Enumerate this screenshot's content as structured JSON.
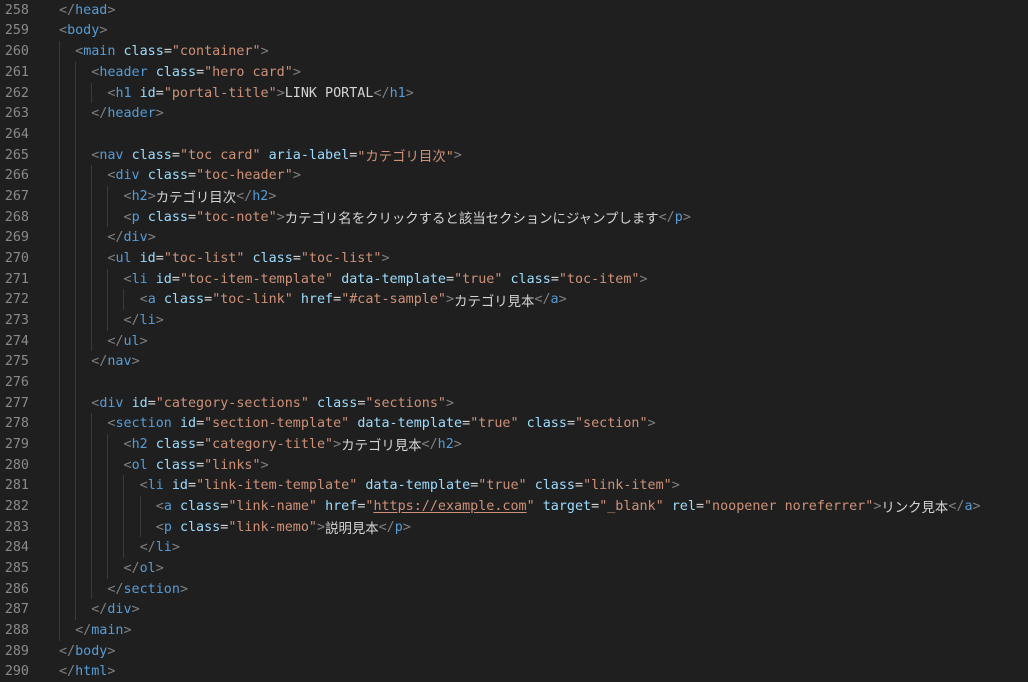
{
  "editor": {
    "language": "html",
    "lines": [
      {
        "num": "258",
        "indent": 0,
        "tokens": [
          [
            "tg",
            "</"
          ],
          [
            "tn",
            "head"
          ],
          [
            "tg",
            ">"
          ]
        ]
      },
      {
        "num": "259",
        "indent": 0,
        "tokens": [
          [
            "tg",
            "<"
          ],
          [
            "tn",
            "body"
          ],
          [
            "tg",
            ">"
          ]
        ]
      },
      {
        "num": "260",
        "indent": 1,
        "tokens": [
          [
            "tg",
            "<"
          ],
          [
            "tn",
            "main"
          ],
          [
            "tx",
            " "
          ],
          [
            "an",
            "class"
          ],
          [
            "eq",
            "="
          ],
          [
            "sv",
            "\"container\""
          ],
          [
            "tg",
            ">"
          ]
        ]
      },
      {
        "num": "261",
        "indent": 2,
        "tokens": [
          [
            "tg",
            "<"
          ],
          [
            "tn",
            "header"
          ],
          [
            "tx",
            " "
          ],
          [
            "an",
            "class"
          ],
          [
            "eq",
            "="
          ],
          [
            "sv",
            "\"hero card\""
          ],
          [
            "tg",
            ">"
          ]
        ]
      },
      {
        "num": "262",
        "indent": 3,
        "tokens": [
          [
            "tg",
            "<"
          ],
          [
            "tn",
            "h1"
          ],
          [
            "tx",
            " "
          ],
          [
            "an",
            "id"
          ],
          [
            "eq",
            "="
          ],
          [
            "sv",
            "\"portal-title\""
          ],
          [
            "tg",
            ">"
          ],
          [
            "tx",
            "LINK PORTAL"
          ],
          [
            "tg",
            "</"
          ],
          [
            "tn",
            "h1"
          ],
          [
            "tg",
            ">"
          ]
        ]
      },
      {
        "num": "263",
        "indent": 2,
        "tokens": [
          [
            "tg",
            "</"
          ],
          [
            "tn",
            "header"
          ],
          [
            "tg",
            ">"
          ]
        ]
      },
      {
        "num": "264",
        "indent": 2,
        "tokens": []
      },
      {
        "num": "265",
        "indent": 2,
        "tokens": [
          [
            "tg",
            "<"
          ],
          [
            "tn",
            "nav"
          ],
          [
            "tx",
            " "
          ],
          [
            "an",
            "class"
          ],
          [
            "eq",
            "="
          ],
          [
            "sv",
            "\"toc card\""
          ],
          [
            "tx",
            " "
          ],
          [
            "an",
            "aria-label"
          ],
          [
            "eq",
            "="
          ],
          [
            "sv",
            "\"カテゴリ目次\""
          ],
          [
            "tg",
            ">"
          ]
        ]
      },
      {
        "num": "266",
        "indent": 3,
        "tokens": [
          [
            "tg",
            "<"
          ],
          [
            "tn",
            "div"
          ],
          [
            "tx",
            " "
          ],
          [
            "an",
            "class"
          ],
          [
            "eq",
            "="
          ],
          [
            "sv",
            "\"toc-header\""
          ],
          [
            "tg",
            ">"
          ]
        ]
      },
      {
        "num": "267",
        "indent": 4,
        "tokens": [
          [
            "tg",
            "<"
          ],
          [
            "tn",
            "h2"
          ],
          [
            "tg",
            ">"
          ],
          [
            "tx",
            "カテゴリ目次"
          ],
          [
            "tg",
            "</"
          ],
          [
            "tn",
            "h2"
          ],
          [
            "tg",
            ">"
          ]
        ]
      },
      {
        "num": "268",
        "indent": 4,
        "tokens": [
          [
            "tg",
            "<"
          ],
          [
            "tn",
            "p"
          ],
          [
            "tx",
            " "
          ],
          [
            "an",
            "class"
          ],
          [
            "eq",
            "="
          ],
          [
            "sv",
            "\"toc-note\""
          ],
          [
            "tg",
            ">"
          ],
          [
            "tx",
            "カテゴリ名をクリックすると該当セクションにジャンプします"
          ],
          [
            "tg",
            "</"
          ],
          [
            "tn",
            "p"
          ],
          [
            "tg",
            ">"
          ]
        ]
      },
      {
        "num": "269",
        "indent": 3,
        "tokens": [
          [
            "tg",
            "</"
          ],
          [
            "tn",
            "div"
          ],
          [
            "tg",
            ">"
          ]
        ]
      },
      {
        "num": "270",
        "indent": 3,
        "tokens": [
          [
            "tg",
            "<"
          ],
          [
            "tn",
            "ul"
          ],
          [
            "tx",
            " "
          ],
          [
            "an",
            "id"
          ],
          [
            "eq",
            "="
          ],
          [
            "sv",
            "\"toc-list\""
          ],
          [
            "tx",
            " "
          ],
          [
            "an",
            "class"
          ],
          [
            "eq",
            "="
          ],
          [
            "sv",
            "\"toc-list\""
          ],
          [
            "tg",
            ">"
          ]
        ]
      },
      {
        "num": "271",
        "indent": 4,
        "tokens": [
          [
            "tg",
            "<"
          ],
          [
            "tn",
            "li"
          ],
          [
            "tx",
            " "
          ],
          [
            "an",
            "id"
          ],
          [
            "eq",
            "="
          ],
          [
            "sv",
            "\"toc-item-template\""
          ],
          [
            "tx",
            " "
          ],
          [
            "an",
            "data-template"
          ],
          [
            "eq",
            "="
          ],
          [
            "sv",
            "\"true\""
          ],
          [
            "tx",
            " "
          ],
          [
            "an",
            "class"
          ],
          [
            "eq",
            "="
          ],
          [
            "sv",
            "\"toc-item\""
          ],
          [
            "tg",
            ">"
          ]
        ]
      },
      {
        "num": "272",
        "indent": 5,
        "tokens": [
          [
            "tg",
            "<"
          ],
          [
            "tn",
            "a"
          ],
          [
            "tx",
            " "
          ],
          [
            "an",
            "class"
          ],
          [
            "eq",
            "="
          ],
          [
            "sv",
            "\"toc-link\""
          ],
          [
            "tx",
            " "
          ],
          [
            "an",
            "href"
          ],
          [
            "eq",
            "="
          ],
          [
            "sv",
            "\"#cat-sample\""
          ],
          [
            "tg",
            ">"
          ],
          [
            "tx",
            "カテゴリ見本"
          ],
          [
            "tg",
            "</"
          ],
          [
            "tn",
            "a"
          ],
          [
            "tg",
            ">"
          ]
        ]
      },
      {
        "num": "273",
        "indent": 4,
        "tokens": [
          [
            "tg",
            "</"
          ],
          [
            "tn",
            "li"
          ],
          [
            "tg",
            ">"
          ]
        ]
      },
      {
        "num": "274",
        "indent": 3,
        "tokens": [
          [
            "tg",
            "</"
          ],
          [
            "tn",
            "ul"
          ],
          [
            "tg",
            ">"
          ]
        ]
      },
      {
        "num": "275",
        "indent": 2,
        "tokens": [
          [
            "tg",
            "</"
          ],
          [
            "tn",
            "nav"
          ],
          [
            "tg",
            ">"
          ]
        ]
      },
      {
        "num": "276",
        "indent": 2,
        "tokens": []
      },
      {
        "num": "277",
        "indent": 2,
        "tokens": [
          [
            "tg",
            "<"
          ],
          [
            "tn",
            "div"
          ],
          [
            "tx",
            " "
          ],
          [
            "an",
            "id"
          ],
          [
            "eq",
            "="
          ],
          [
            "sv",
            "\"category-sections\""
          ],
          [
            "tx",
            " "
          ],
          [
            "an",
            "class"
          ],
          [
            "eq",
            "="
          ],
          [
            "sv",
            "\"sections\""
          ],
          [
            "tg",
            ">"
          ]
        ]
      },
      {
        "num": "278",
        "indent": 3,
        "tokens": [
          [
            "tg",
            "<"
          ],
          [
            "tn",
            "section"
          ],
          [
            "tx",
            " "
          ],
          [
            "an",
            "id"
          ],
          [
            "eq",
            "="
          ],
          [
            "sv",
            "\"section-template\""
          ],
          [
            "tx",
            " "
          ],
          [
            "an",
            "data-template"
          ],
          [
            "eq",
            "="
          ],
          [
            "sv",
            "\"true\""
          ],
          [
            "tx",
            " "
          ],
          [
            "an",
            "class"
          ],
          [
            "eq",
            "="
          ],
          [
            "sv",
            "\"section\""
          ],
          [
            "tg",
            ">"
          ]
        ]
      },
      {
        "num": "279",
        "indent": 4,
        "tokens": [
          [
            "tg",
            "<"
          ],
          [
            "tn",
            "h2"
          ],
          [
            "tx",
            " "
          ],
          [
            "an",
            "class"
          ],
          [
            "eq",
            "="
          ],
          [
            "sv",
            "\"category-title\""
          ],
          [
            "tg",
            ">"
          ],
          [
            "tx",
            "カテゴリ見本"
          ],
          [
            "tg",
            "</"
          ],
          [
            "tn",
            "h2"
          ],
          [
            "tg",
            ">"
          ]
        ]
      },
      {
        "num": "280",
        "indent": 4,
        "tokens": [
          [
            "tg",
            "<"
          ],
          [
            "tn",
            "ol"
          ],
          [
            "tx",
            " "
          ],
          [
            "an",
            "class"
          ],
          [
            "eq",
            "="
          ],
          [
            "sv",
            "\"links\""
          ],
          [
            "tg",
            ">"
          ]
        ]
      },
      {
        "num": "281",
        "indent": 5,
        "tokens": [
          [
            "tg",
            "<"
          ],
          [
            "tn",
            "li"
          ],
          [
            "tx",
            " "
          ],
          [
            "an",
            "id"
          ],
          [
            "eq",
            "="
          ],
          [
            "sv",
            "\"link-item-template\""
          ],
          [
            "tx",
            " "
          ],
          [
            "an",
            "data-template"
          ],
          [
            "eq",
            "="
          ],
          [
            "sv",
            "\"true\""
          ],
          [
            "tx",
            " "
          ],
          [
            "an",
            "class"
          ],
          [
            "eq",
            "="
          ],
          [
            "sv",
            "\"link-item\""
          ],
          [
            "tg",
            ">"
          ]
        ]
      },
      {
        "num": "282",
        "indent": 6,
        "tokens": [
          [
            "tg",
            "<"
          ],
          [
            "tn",
            "a"
          ],
          [
            "tx",
            " "
          ],
          [
            "an",
            "class"
          ],
          [
            "eq",
            "="
          ],
          [
            "sv",
            "\"link-name\""
          ],
          [
            "tx",
            " "
          ],
          [
            "an",
            "href"
          ],
          [
            "eq",
            "="
          ],
          [
            "sv",
            "\""
          ],
          [
            "url",
            "https://example.com"
          ],
          [
            "sv",
            "\""
          ],
          [
            "tx",
            " "
          ],
          [
            "an",
            "target"
          ],
          [
            "eq",
            "="
          ],
          [
            "sv",
            "\"_blank\""
          ],
          [
            "tx",
            " "
          ],
          [
            "an",
            "rel"
          ],
          [
            "eq",
            "="
          ],
          [
            "sv",
            "\"noopener noreferrer\""
          ],
          [
            "tg",
            ">"
          ],
          [
            "tx",
            "リンク見本"
          ],
          [
            "tg",
            "</"
          ],
          [
            "tn",
            "a"
          ],
          [
            "tg",
            ">"
          ]
        ]
      },
      {
        "num": "283",
        "indent": 6,
        "tokens": [
          [
            "tg",
            "<"
          ],
          [
            "tn",
            "p"
          ],
          [
            "tx",
            " "
          ],
          [
            "an",
            "class"
          ],
          [
            "eq",
            "="
          ],
          [
            "sv",
            "\"link-memo\""
          ],
          [
            "tg",
            ">"
          ],
          [
            "tx",
            "説明見本"
          ],
          [
            "tg",
            "</"
          ],
          [
            "tn",
            "p"
          ],
          [
            "tg",
            ">"
          ]
        ]
      },
      {
        "num": "284",
        "indent": 5,
        "tokens": [
          [
            "tg",
            "</"
          ],
          [
            "tn",
            "li"
          ],
          [
            "tg",
            ">"
          ]
        ]
      },
      {
        "num": "285",
        "indent": 4,
        "tokens": [
          [
            "tg",
            "</"
          ],
          [
            "tn",
            "ol"
          ],
          [
            "tg",
            ">"
          ]
        ]
      },
      {
        "num": "286",
        "indent": 3,
        "tokens": [
          [
            "tg",
            "</"
          ],
          [
            "tn",
            "section"
          ],
          [
            "tg",
            ">"
          ]
        ]
      },
      {
        "num": "287",
        "indent": 2,
        "tokens": [
          [
            "tg",
            "</"
          ],
          [
            "tn",
            "div"
          ],
          [
            "tg",
            ">"
          ]
        ]
      },
      {
        "num": "288",
        "indent": 1,
        "tokens": [
          [
            "tg",
            "</"
          ],
          [
            "tn",
            "main"
          ],
          [
            "tg",
            ">"
          ]
        ]
      },
      {
        "num": "289",
        "indent": 0,
        "tokens": [
          [
            "tg",
            "</"
          ],
          [
            "tn",
            "body"
          ],
          [
            "tg",
            ">"
          ]
        ]
      },
      {
        "num": "290",
        "indent": 0,
        "tokens": [
          [
            "tg",
            "</"
          ],
          [
            "tn",
            "html"
          ],
          [
            "tg",
            ">"
          ]
        ]
      }
    ]
  }
}
